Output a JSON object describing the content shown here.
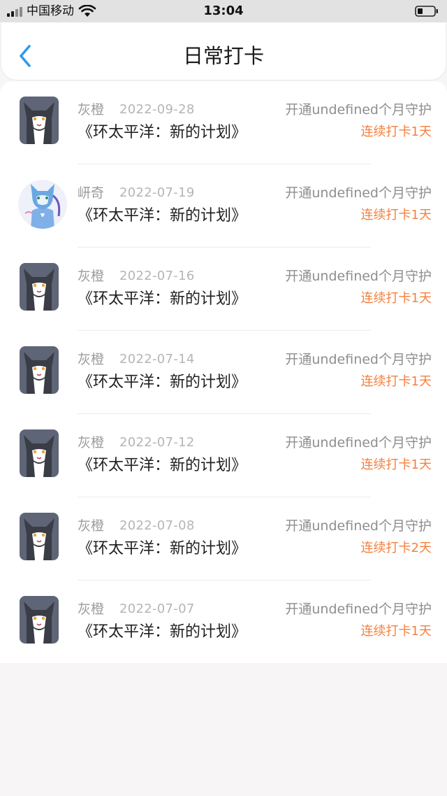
{
  "status_bar": {
    "carrier": "中国移动",
    "time": "13:04",
    "icons": [
      "signal-icon",
      "wifi-icon",
      "battery-icon"
    ]
  },
  "nav": {
    "title": "日常打卡",
    "back_icon": "chevron-left-icon"
  },
  "colors": {
    "accent_back": "#2f9be8",
    "streak": "#f5803e",
    "muted_text": "#9b9b9b",
    "page_bg": "#f7f5f6"
  },
  "checkins": [
    {
      "user": "灰橙",
      "date": "2022-09-28",
      "content": "《环太平洋：新的计划》",
      "guard": "开通undefined个月守护",
      "streak": "连续打卡1天",
      "avatar": "gray-cat-avatar"
    },
    {
      "user": "岍奇",
      "date": "2022-07-19",
      "content": "《环太平洋：新的计划》",
      "guard": "开通undefined个月守护",
      "streak": "连续打卡1天",
      "avatar": "blue-cat-avatar"
    },
    {
      "user": "灰橙",
      "date": "2022-07-16",
      "content": "《环太平洋：新的计划》",
      "guard": "开通undefined个月守护",
      "streak": "连续打卡1天",
      "avatar": "gray-cat-avatar"
    },
    {
      "user": "灰橙",
      "date": "2022-07-14",
      "content": "《环太平洋：新的计划》",
      "guard": "开通undefined个月守护",
      "streak": "连续打卡1天",
      "avatar": "gray-cat-avatar"
    },
    {
      "user": "灰橙",
      "date": "2022-07-12",
      "content": "《环太平洋：新的计划》",
      "guard": "开通undefined个月守护",
      "streak": "连续打卡1天",
      "avatar": "gray-cat-avatar"
    },
    {
      "user": "灰橙",
      "date": "2022-07-08",
      "content": "《环太平洋：新的计划》",
      "guard": "开通undefined个月守护",
      "streak": "连续打卡2天",
      "avatar": "gray-cat-avatar"
    },
    {
      "user": "灰橙",
      "date": "2022-07-07",
      "content": "《环太平洋：新的计划》",
      "guard": "开通undefined个月守护",
      "streak": "连续打卡1天",
      "avatar": "gray-cat-avatar"
    }
  ]
}
